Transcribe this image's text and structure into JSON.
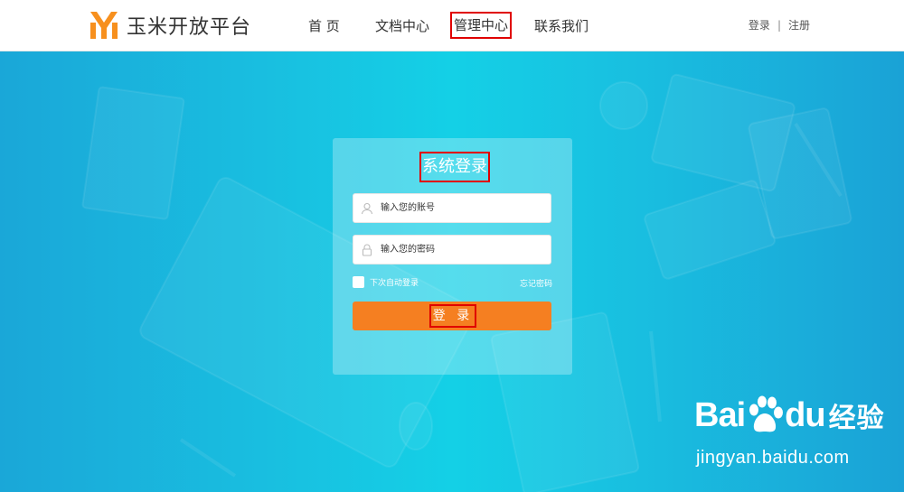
{
  "header": {
    "logo_text": "玉米开放平台",
    "nav": {
      "home": "首 页",
      "docs": "文档中心",
      "manage": "管理中心",
      "contact": "联系我们"
    },
    "login_link": "登录",
    "separator": "|",
    "register_link": "注册"
  },
  "login": {
    "title": "系统登录",
    "account_placeholder": "输入您的账号",
    "password_placeholder": "输入您的密码",
    "remember_label": "下次自动登录",
    "forgot_label": "忘记密码",
    "submit_label": "登 录"
  },
  "icons": {
    "logo": "ym-logo-icon",
    "user": "user-icon",
    "lock": "lock-icon",
    "paw": "baidu-paw-icon"
  },
  "colors": {
    "logo_orange": "#f7901e",
    "button_orange": "#f57f21",
    "hero_cyan": "#19bfe0",
    "highlight_red": "#e00000"
  },
  "watermark": {
    "brand": "Bai",
    "brand_suffix": "du",
    "brand_cn": "经验",
    "url": "jingyan.baidu.com"
  }
}
